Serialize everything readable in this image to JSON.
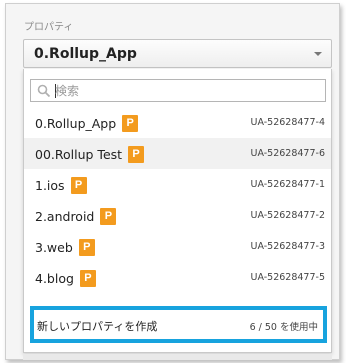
{
  "property_section": {
    "label": "プロパティ",
    "selected_value": "0.Rollup_App"
  },
  "search": {
    "placeholder": "検索",
    "value": ""
  },
  "properties": [
    {
      "name": "0.Rollup_App",
      "badge": "P",
      "id": "UA-52628477-4",
      "selected": false
    },
    {
      "name": "00.Rollup Test",
      "badge": "P",
      "id": "UA-52628477-6",
      "selected": true
    },
    {
      "name": "1.ios",
      "badge": "P",
      "id": "UA-52628477-1",
      "selected": false
    },
    {
      "name": "2.android",
      "badge": "P",
      "id": "UA-52628477-2",
      "selected": false
    },
    {
      "name": "3.web",
      "badge": "P",
      "id": "UA-52628477-3",
      "selected": false
    },
    {
      "name": "4.blog",
      "badge": "P",
      "id": "UA-52628477-5",
      "selected": false
    }
  ],
  "footer": {
    "create_label": "新しいプロパティを作成",
    "usage": "6 / 50 を使用中"
  },
  "colors": {
    "badge": "#f39b1e",
    "highlight_border": "#17a3de"
  },
  "icons": {
    "search": "magnifier-icon",
    "caret": "caret-down-icon"
  }
}
